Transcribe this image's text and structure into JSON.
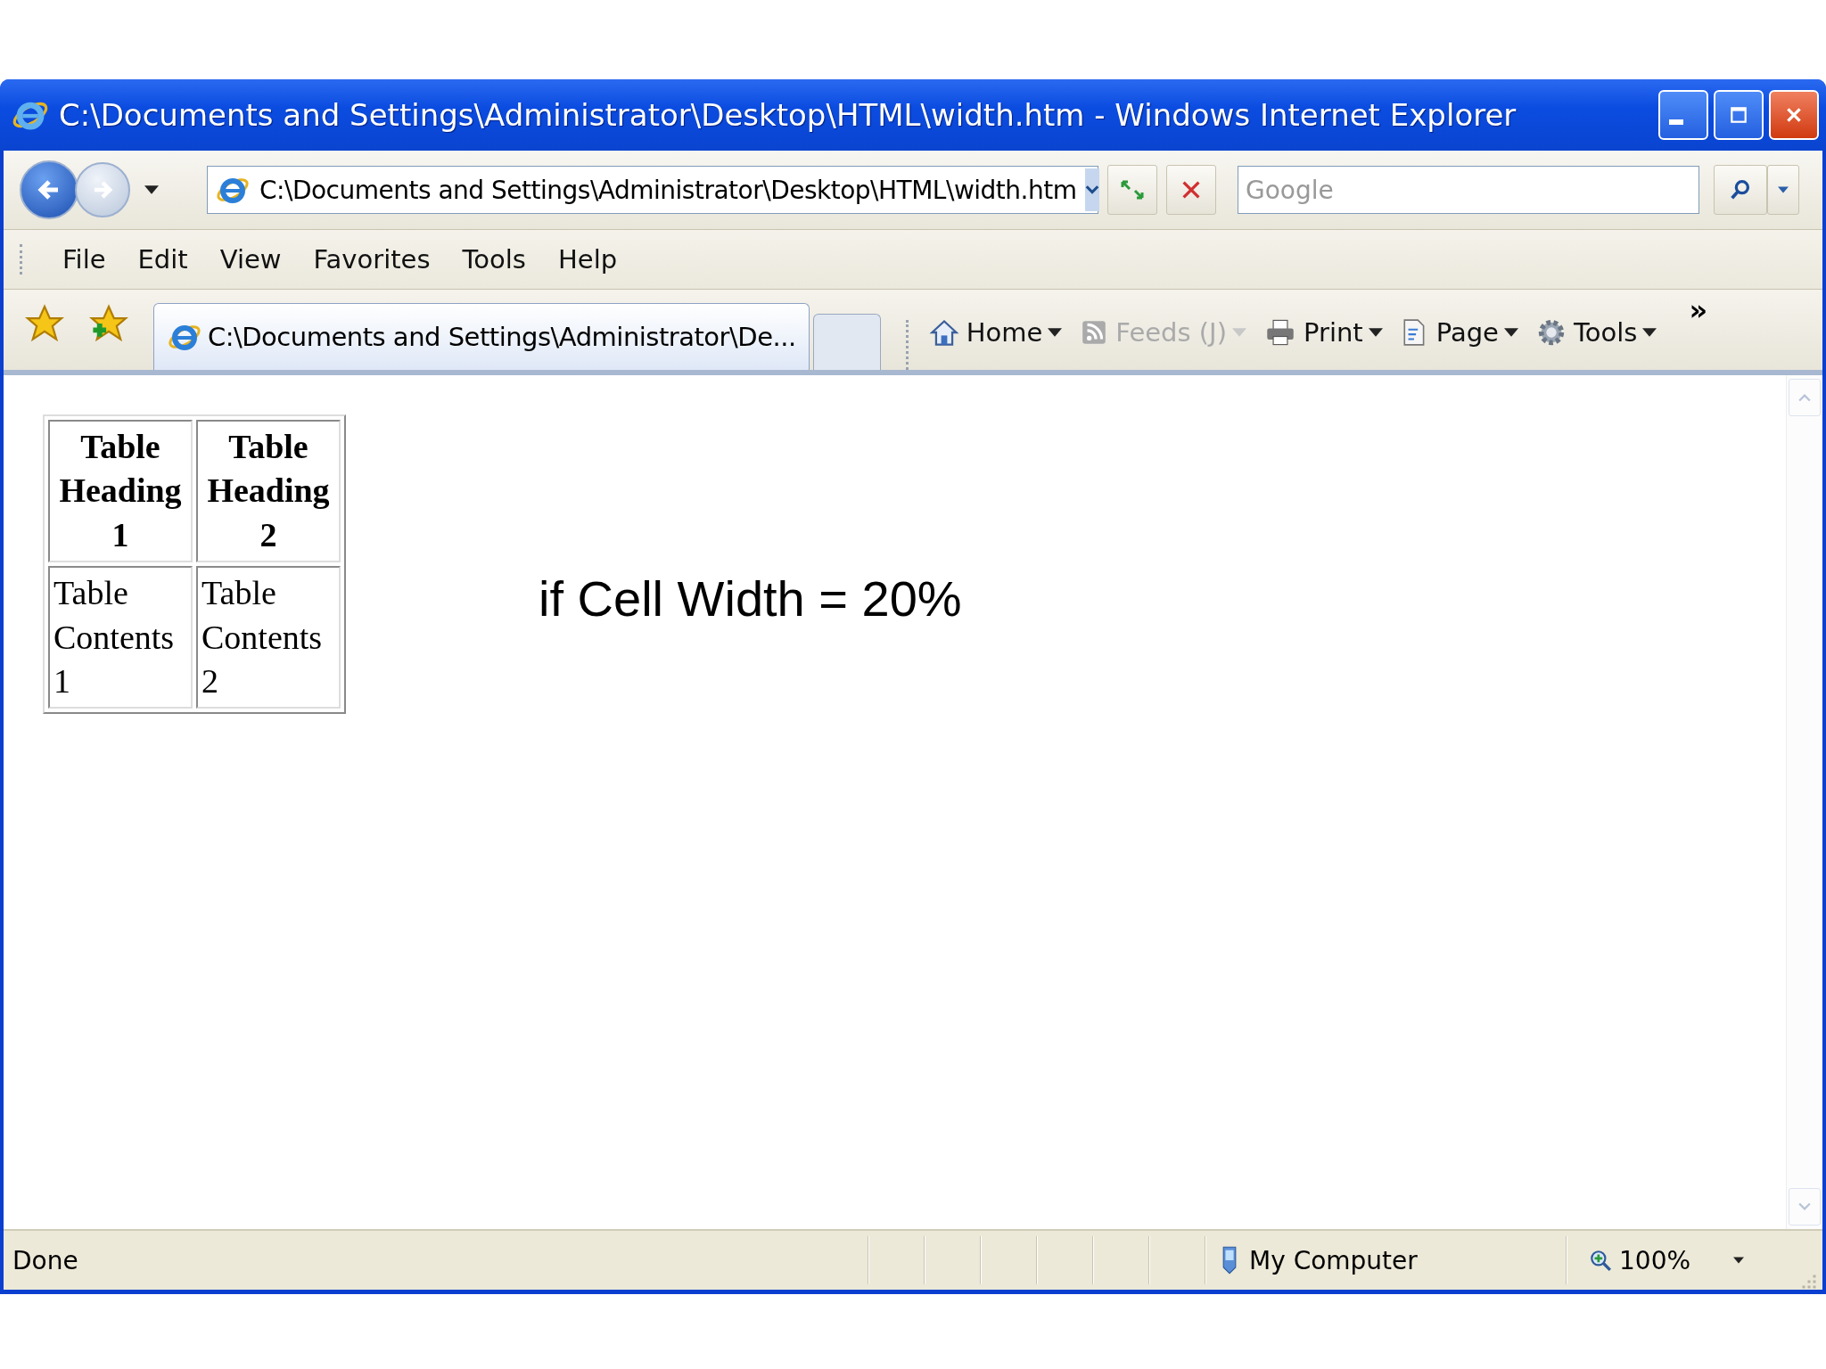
{
  "window": {
    "title": "C:\\Documents and Settings\\Administrator\\Desktop\\HTML\\width.htm - Windows Internet Explorer"
  },
  "address_bar": {
    "value": "C:\\Documents and Settings\\Administrator\\Desktop\\HTML\\width.htm"
  },
  "search": {
    "placeholder": "Google"
  },
  "menu": [
    "File",
    "Edit",
    "View",
    "Favorites",
    "Tools",
    "Help"
  ],
  "tabs": [
    {
      "label": "C:\\Documents and Settings\\Administrator\\De...",
      "selected": true
    }
  ],
  "command_bar": [
    {
      "label": "Home",
      "kind": "home",
      "disabled": false
    },
    {
      "label": "Feeds (J)",
      "kind": "feed",
      "disabled": true
    },
    {
      "label": "Print",
      "kind": "print",
      "disabled": false
    },
    {
      "label": "Page",
      "kind": "page",
      "disabled": false
    },
    {
      "label": "Tools",
      "kind": "gear",
      "disabled": false
    }
  ],
  "chevron": "»",
  "page": {
    "table": {
      "headers": [
        "Table Heading 1",
        "Table Heading 2"
      ],
      "rows": [
        [
          "Table Contents 1",
          "Table Contents 2"
        ]
      ]
    },
    "note": "if Cell Width = 20%"
  },
  "status_bar": {
    "text": "Done",
    "zone": "My Computer",
    "zoom": "100%"
  }
}
